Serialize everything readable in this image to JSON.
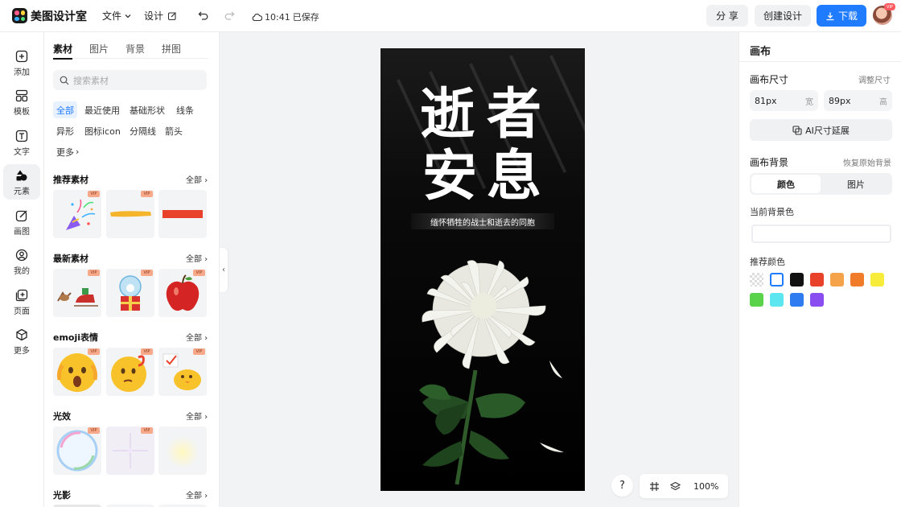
{
  "app": {
    "name": "美图设计室"
  },
  "header": {
    "menu_file": "文件",
    "menu_design": "设计",
    "save_time": "10:41",
    "save_status": "已保存",
    "share": "分 享",
    "create": "创建设计",
    "download": "下载",
    "avatar_badge": "VIP"
  },
  "leftnav": {
    "items": [
      {
        "label": "添加",
        "icon": "plus-square-icon"
      },
      {
        "label": "模板",
        "icon": "template-icon"
      },
      {
        "label": "文字",
        "icon": "text-icon"
      },
      {
        "label": "元素",
        "icon": "shapes-icon"
      },
      {
        "label": "画图",
        "icon": "draw-icon"
      },
      {
        "label": "我的",
        "icon": "user-icon"
      },
      {
        "label": "页面",
        "icon": "page-add-icon"
      },
      {
        "label": "更多",
        "icon": "cube-icon"
      }
    ],
    "active": "元素"
  },
  "panel": {
    "tabs": [
      "素材",
      "图片",
      "背景",
      "拼图"
    ],
    "active_tab": "素材",
    "search_placeholder": "搜索素材",
    "chips": [
      "全部",
      "最近使用",
      "基础形状",
      "线条",
      "异形",
      "图标icon",
      "分隔线",
      "箭头",
      "更多"
    ],
    "active_chip": "全部",
    "all_label": "全部",
    "vip_label": "VIP",
    "sections": [
      {
        "title": "推荐素材",
        "items": [
          "party-popper",
          "yellow-brush-stroke",
          "red-rectangle"
        ],
        "vip": [
          true,
          true,
          false
        ]
      },
      {
        "title": "最新素材",
        "items": [
          "sleigh-reindeer",
          "christmas-snow-globe",
          "red-apple"
        ],
        "vip": [
          true,
          true,
          true
        ]
      },
      {
        "title": "emoji表情",
        "items": [
          "shocked-emoji",
          "thinking-emoji",
          "chick-emoji"
        ],
        "vip": [
          true,
          true,
          true
        ]
      },
      {
        "title": "光效",
        "items": [
          "rainbow-bubble",
          "star-sparkle",
          "glow-light"
        ],
        "vip": [
          true,
          true,
          false
        ]
      },
      {
        "title": "光影",
        "items": [],
        "vip": []
      }
    ]
  },
  "canvas": {
    "headline": [
      "逝",
      "者",
      "安",
      "息"
    ],
    "subtitle": "缅怀牺牲的战士和逝去的同胞",
    "background": "#000000",
    "image": "white-chrysanthemum"
  },
  "rightpanel": {
    "title": "画布",
    "size_label": "画布尺寸",
    "adjust_size": "调整尺寸",
    "width_value": "81px",
    "width_unit": "宽",
    "height_value": "89px",
    "height_unit": "高",
    "ai_extend": "AI尺寸延展",
    "bg_label": "画布背景",
    "restore_bg": "恢复原始背景",
    "seg_color": "颜色",
    "seg_image": "图片",
    "current_bg": "当前背景色",
    "recommended": "推荐颜色",
    "swatches": [
      "transparent",
      "#ffffff",
      "#111111",
      "#e8432a",
      "#f5a34a",
      "#f07c2a",
      "#f8ec3a",
      "#5ad34a",
      "#5ce6f0",
      "#2f7cf0",
      "#8a4ef0"
    ]
  },
  "bottom": {
    "help": "?",
    "zoom": "100%"
  }
}
